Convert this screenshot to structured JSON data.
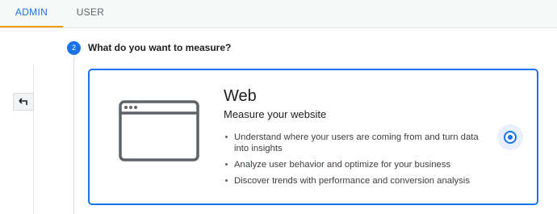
{
  "tabs": [
    {
      "label": "ADMIN",
      "active": true
    },
    {
      "label": "USER",
      "active": false
    }
  ],
  "back_button": {
    "icon": "back-arrow-icon"
  },
  "step": {
    "number": "2",
    "title": "What do you want to measure?"
  },
  "option": {
    "title": "Web",
    "subtitle": "Measure your website",
    "icon": "browser-window-icon",
    "bullets": [
      "Understand where your users are coming from and turn data into insights",
      "Analyze user behavior and optimize for your business",
      "Discover trends with performance and conversion analysis"
    ],
    "selected": true
  },
  "colors": {
    "accent": "#1a73e8",
    "tab_indicator": "#f29900",
    "text": "#202124"
  }
}
